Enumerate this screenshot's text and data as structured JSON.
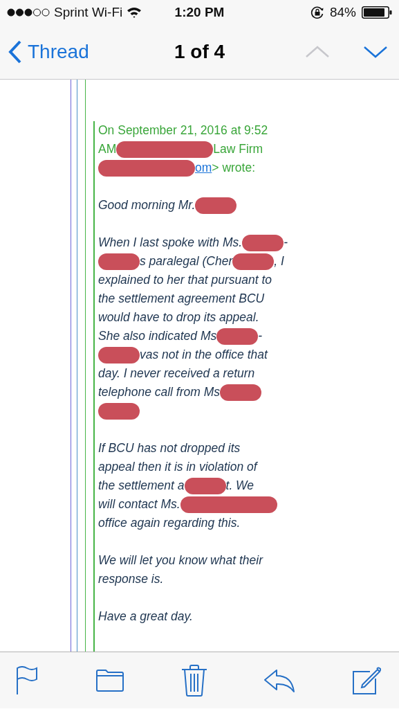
{
  "status_bar": {
    "carrier": "Sprint Wi-Fi",
    "time": "1:20 PM",
    "battery": "84%"
  },
  "nav": {
    "back": "Thread",
    "title": "1 of 4",
    "arrows": [
      {
        "kind": "up",
        "disabled": true
      },
      {
        "kind": "down",
        "disabled": false
      }
    ]
  },
  "message": {
    "header_lines": [
      {
        "parts": [
          {
            "kind": "text",
            "text": "On September 21, 2016 at 9:52"
          }
        ]
      },
      {
        "parts": [
          {
            "kind": "text",
            "text": "AM"
          },
          {
            "kind": "longredaction"
          },
          {
            "kind": "text",
            "text": "Law Firm"
          }
        ]
      },
      {
        "parts": [
          {
            "kind": "longredaction"
          },
          {
            "kind": "link",
            "text": "om"
          },
          {
            "kind": "text",
            "text": "> wrote:"
          }
        ]
      }
    ],
    "paragraphs": [
      {
        "lines": [
          {
            "parts": [
              {
                "kind": "text",
                "text": "Good morning Mr."
              },
              {
                "kind": "redaction"
              }
            ]
          }
        ]
      },
      {
        "lines": [
          {
            "parts": [
              {
                "kind": "text",
                "text": "When I last spoke with Ms."
              },
              {
                "kind": "redaction"
              },
              {
                "kind": "text",
                "text": "-"
              }
            ]
          },
          {
            "parts": [
              {
                "kind": "redaction"
              },
              {
                "kind": "text",
                "text": "s paralegal (Cher"
              },
              {
                "kind": "redaction"
              },
              {
                "kind": "text",
                "text": ", I"
              }
            ]
          },
          {
            "parts": [
              {
                "kind": "text",
                "text": "explained to her that pursuant to"
              }
            ]
          },
          {
            "parts": [
              {
                "kind": "text",
                "text": "the settlement agreement BCU"
              }
            ]
          },
          {
            "parts": [
              {
                "kind": "text",
                "text": "would have to drop its appeal."
              }
            ]
          },
          {
            "parts": [
              {
                "kind": "text",
                "text": "She also indicated Ms"
              },
              {
                "kind": "redaction"
              },
              {
                "kind": "text",
                "text": "-"
              }
            ]
          },
          {
            "parts": [
              {
                "kind": "redaction"
              },
              {
                "kind": "text",
                "text": "vas not in the office that"
              }
            ]
          },
          {
            "parts": [
              {
                "kind": "text",
                "text": "day. I never received a return"
              }
            ]
          },
          {
            "parts": [
              {
                "kind": "text",
                "text": "telephone call from Ms"
              },
              {
                "kind": "redaction"
              }
            ]
          },
          {
            "parts": [
              {
                "kind": "redaction"
              }
            ]
          }
        ]
      },
      {
        "lines": [
          {
            "parts": [
              {
                "kind": "text",
                "text": "If BCU has not dropped its"
              }
            ]
          },
          {
            "parts": [
              {
                "kind": "text",
                "text": "appeal then it is in violation of"
              }
            ]
          },
          {
            "parts": [
              {
                "kind": "text",
                "text": "the settlement a"
              },
              {
                "kind": "redaction"
              },
              {
                "kind": "text",
                "text": "t. We"
              }
            ]
          },
          {
            "parts": [
              {
                "kind": "text",
                "text": "will contact Ms."
              },
              {
                "kind": "longredaction"
              }
            ]
          },
          {
            "parts": [
              {
                "kind": "text",
                "text": "office again regarding this."
              }
            ]
          }
        ]
      },
      {
        "lines": [
          {
            "parts": [
              {
                "kind": "text",
                "text": "We will let you know what their"
              }
            ]
          },
          {
            "parts": [
              {
                "kind": "text",
                "text": "response is."
              }
            ]
          }
        ]
      },
      {
        "lines": [
          {
            "parts": [
              {
                "kind": "text",
                "text": "Have a great day."
              }
            ]
          }
        ]
      }
    ]
  }
}
